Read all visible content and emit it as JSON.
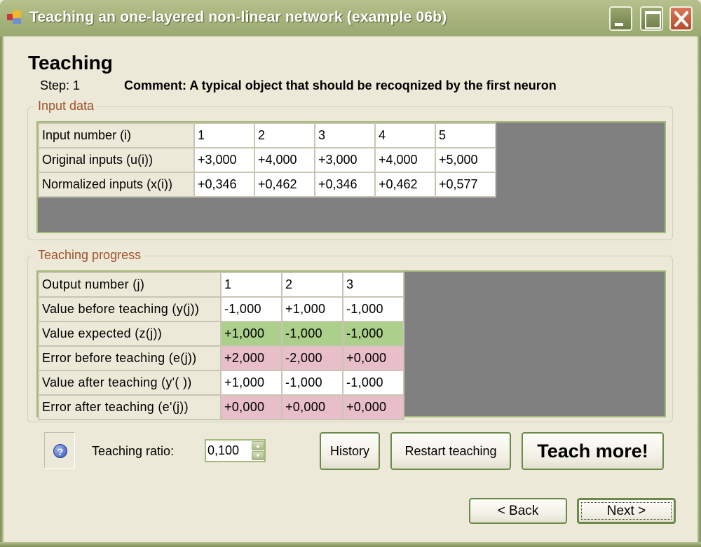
{
  "window": {
    "title": "Teaching an one-layered non-linear network (example 06b)",
    "controls": [
      "minimize",
      "maximize",
      "close"
    ]
  },
  "header": {
    "title": "Teaching",
    "step": "Step: 1",
    "comment": "Comment: A typical object that should be recoqnized by the first neuron"
  },
  "input_data": {
    "legend": "Input data",
    "rows": [
      {
        "label": "Input number (i)",
        "values": [
          "1",
          "2",
          "3",
          "4",
          "5"
        ]
      },
      {
        "label": "Original inputs (u(i))",
        "values": [
          "+3,000",
          "+4,000",
          "+3,000",
          "+4,000",
          "+5,000"
        ]
      },
      {
        "label": "Normalized inputs (x(i))",
        "values": [
          "+0,346",
          "+0,462",
          "+0,346",
          "+0,462",
          "+0,577"
        ]
      }
    ]
  },
  "teaching_progress": {
    "legend": "Teaching progress",
    "rows": [
      {
        "label": "Output number (j)",
        "values": [
          "1",
          "2",
          "3"
        ],
        "style": "val"
      },
      {
        "label": "Value before teaching (y(j))",
        "values": [
          "-1,000",
          "+1,000",
          "-1,000"
        ],
        "style": "val"
      },
      {
        "label": "Value expected (z(j))",
        "values": [
          "+1,000",
          "-1,000",
          "-1,000"
        ],
        "style": "green"
      },
      {
        "label": "Error before teaching (e(j))",
        "values": [
          "+2,000",
          "-2,000",
          "+0,000"
        ],
        "style": "pink"
      },
      {
        "label": "Value after teaching (y'( ))",
        "values": [
          "+1,000",
          "-1,000",
          "-1,000"
        ],
        "style": "val"
      },
      {
        "label": "Error after teaching (e'(j))",
        "values": [
          "+0,000",
          "+0,000",
          "+0,000"
        ],
        "style": "pink"
      }
    ],
    "colors": {
      "expected": "#acd08b",
      "error": "#e8bec8"
    }
  },
  "controls": {
    "help_icon": "question-mark",
    "teaching_ratio_label": "Teaching ratio:",
    "teaching_ratio_value": "0,100",
    "history": "History",
    "restart": "Restart teaching",
    "teach_more": "Teach more!",
    "back": "< Back",
    "next": "Next >"
  }
}
